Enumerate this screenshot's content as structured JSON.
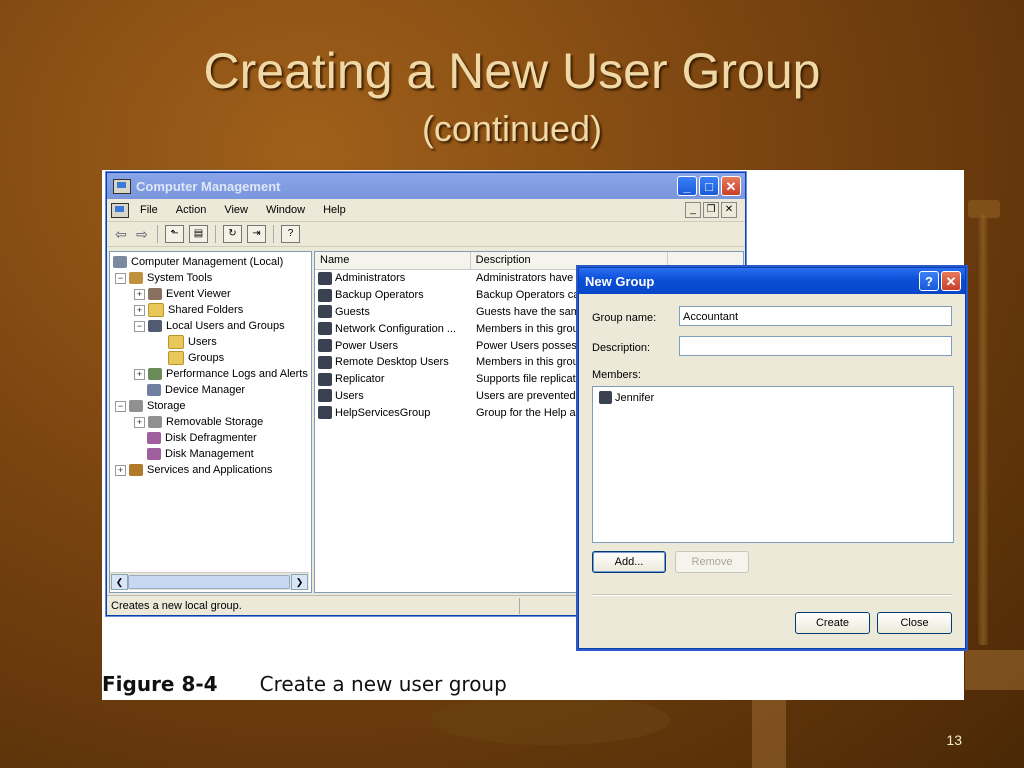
{
  "slide": {
    "title": "Creating a New User Group",
    "subtitle": "(continued)",
    "page_number": "13"
  },
  "caption": {
    "label": "Figure 8-4",
    "text": "Create a new user group"
  },
  "main_window": {
    "title": "Computer Management",
    "menu": [
      "File",
      "Action",
      "View",
      "Window",
      "Help"
    ],
    "tree": [
      {
        "label": "Computer Management (Local)",
        "level": 0,
        "icon": "computer-icon",
        "expander": ""
      },
      {
        "label": "System Tools",
        "level": 1,
        "icon": "tools-icon",
        "expander": "−"
      },
      {
        "label": "Event Viewer",
        "level": 2,
        "icon": "event-viewer-icon",
        "expander": "+"
      },
      {
        "label": "Shared Folders",
        "level": 2,
        "icon": "folder-icon",
        "expander": "+"
      },
      {
        "label": "Local Users and Groups",
        "level": 2,
        "icon": "users-icon",
        "expander": "−"
      },
      {
        "label": "Users",
        "level": 3,
        "icon": "folder-icon",
        "expander": ""
      },
      {
        "label": "Groups",
        "level": 3,
        "icon": "folder-icon",
        "expander": ""
      },
      {
        "label": "Performance Logs and Alerts",
        "level": 2,
        "icon": "performance-icon",
        "expander": "+"
      },
      {
        "label": "Device Manager",
        "level": 2,
        "icon": "device-manager-icon",
        "expander": ""
      },
      {
        "label": "Storage",
        "level": 1,
        "icon": "storage-icon",
        "expander": "−"
      },
      {
        "label": "Removable Storage",
        "level": 2,
        "icon": "storage-icon",
        "expander": "+"
      },
      {
        "label": "Disk Defragmenter",
        "level": 2,
        "icon": "disk-icon",
        "expander": ""
      },
      {
        "label": "Disk Management",
        "level": 2,
        "icon": "disk-icon",
        "expander": ""
      },
      {
        "label": "Services and Applications",
        "level": 1,
        "icon": "services-icon",
        "expander": "+"
      }
    ],
    "columns": [
      "Name",
      "Description"
    ],
    "groups": [
      {
        "name": "Administrators",
        "description": "Administrators have co"
      },
      {
        "name": "Backup Operators",
        "description": "Backup Operators can"
      },
      {
        "name": "Guests",
        "description": "Guests have the same"
      },
      {
        "name": "Network Configuration ...",
        "description": "Members in this group"
      },
      {
        "name": "Power Users",
        "description": "Power Users possess m"
      },
      {
        "name": "Remote Desktop Users",
        "description": "Members in this group"
      },
      {
        "name": "Replicator",
        "description": "Supports file replicatio"
      },
      {
        "name": "Users",
        "description": "Users are prevented fr"
      },
      {
        "name": "HelpServicesGroup",
        "description": "Group for the Help and"
      }
    ],
    "status": "Creates a new local group."
  },
  "dialog": {
    "title": "New Group",
    "help_label": "?",
    "group_name_label": "Group name:",
    "group_name_value": "Accountant",
    "description_label": "Description:",
    "description_value": "",
    "members_label": "Members:",
    "members": [
      "Jennifer"
    ],
    "add_label": "Add...",
    "remove_label": "Remove",
    "create_label": "Create",
    "close_label": "Close"
  }
}
